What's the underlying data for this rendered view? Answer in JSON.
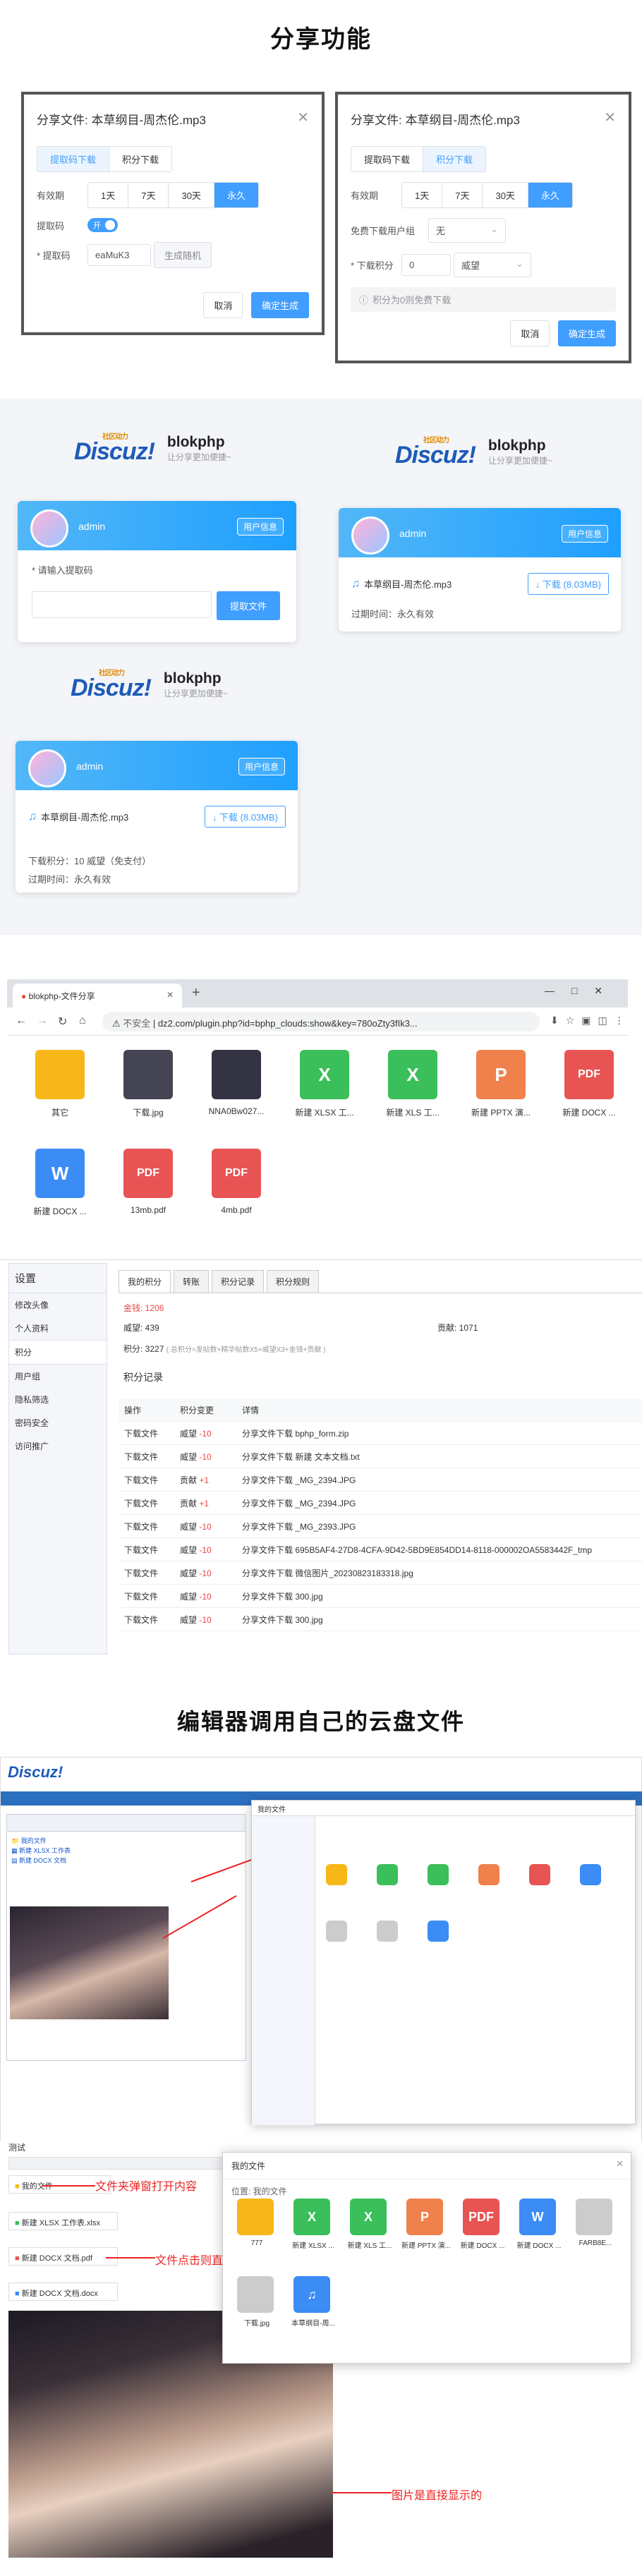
{
  "s1": {
    "title": "分享功能"
  },
  "dlgA": {
    "title": "分享文件: 本草纲目-周杰伦.mp3",
    "tabs": [
      "提取码下载",
      "积分下载"
    ],
    "validity_label": "有效期",
    "validity_opts": [
      "1天",
      "7天",
      "30天",
      "永久"
    ],
    "code_label": "提取码",
    "switch_text": "开",
    "code_label2": "* 提取码",
    "code_value": "eaMuK3",
    "gen_btn": "生成随机",
    "cancel": "取消",
    "ok": "确定生成"
  },
  "dlgB": {
    "title": "分享文件: 本草纲目-周杰伦.mp3",
    "tabs": [
      "提取码下载",
      "积分下载"
    ],
    "validity_label": "有效期",
    "validity_opts": [
      "1天",
      "7天",
      "30天",
      "永久"
    ],
    "group_label": "免费下载用户组",
    "group_value": "无",
    "points_label": "* 下载积分",
    "points_value": "0",
    "points_unit": "威望",
    "hint": "积分为0则免费下载",
    "cancel": "取消",
    "ok": "确定生成"
  },
  "brand": {
    "logo": "Discuz!",
    "logo_small": "社区动力",
    "name": "blokphp",
    "slogan": "让分享更加便捷~"
  },
  "cardA": {
    "user": "admin",
    "center": "用户信息",
    "label": "* 请输入提取码",
    "btn": "提取文件"
  },
  "cardB": {
    "user": "admin",
    "center": "用户信息",
    "file": "本草纲目-周杰伦.mp3",
    "dl": "↓ 下载 (8.03MB)",
    "expire": "过期时间：永久有效"
  },
  "cardC": {
    "user": "admin",
    "center": "用户信息",
    "file": "本草纲目-周杰伦.mp3",
    "dl": "↓ 下载 (8.03MB)",
    "points": "下载积分：10 威望（免支付）",
    "expire": "过期时间：永久有效"
  },
  "browser": {
    "tab": "blokphp-文件分享",
    "url": "dz2.com/plugin.php?id=bphp_clouds:show&key=780oZty3fIk3...",
    "insecure": "不安全"
  },
  "files": [
    {
      "name": "其它",
      "icon": "folder-icon",
      "color": "#f7b719"
    },
    {
      "name": "下载.jpg",
      "icon": "image-icon",
      "color": "#445"
    },
    {
      "name": "NNA0Bw027...",
      "icon": "image-icon",
      "color": "#334"
    },
    {
      "name": "新建 XLSX 工...",
      "icon": "xlsx-icon",
      "color": "#3bbf5a",
      "g": "X"
    },
    {
      "name": "新建 XLS 工...",
      "icon": "xls-icon",
      "color": "#3bbf5a",
      "g": "X"
    },
    {
      "name": "新建 PPTX 演...",
      "icon": "pptx-icon",
      "color": "#f0814d",
      "g": "P"
    },
    {
      "name": "新建 DOCX ...",
      "icon": "pdf-icon",
      "color": "#e85454",
      "g": "PDF"
    },
    {
      "name": "新建 DOCX ...",
      "icon": "docx-icon",
      "color": "#3b8cf5",
      "g": "W"
    },
    {
      "name": "13mb.pdf",
      "icon": "pdf-icon",
      "color": "#e85454",
      "g": "PDF"
    },
    {
      "name": "4mb.pdf",
      "icon": "pdf-icon",
      "color": "#e85454",
      "g": "PDF"
    }
  ],
  "settings": {
    "side": [
      "设置",
      "修改头像",
      "个人资料",
      "积分",
      "用户组",
      "隐私筛选",
      "密码安全",
      "访问推广"
    ],
    "tabs": [
      "我的积分",
      "转账",
      "积分记录",
      "积分规则"
    ],
    "gold": "金钱: 1206",
    "prestige": "威望: 439",
    "contrib": "贡献: 1071",
    "total": "积分: 3227",
    "total_note": "( 总积分=发帖数+精华帖数X5+威望X3+金钱+贡献 )",
    "records": "积分记录",
    "cols": [
      "操作",
      "积分变更",
      "详情"
    ]
  },
  "rows": [
    [
      "下载文件",
      "威望 -10",
      "分享文件下载 bphp_form.zip"
    ],
    [
      "下载文件",
      "威望 -10",
      "分享文件下载 新建 文本文档.txt"
    ],
    [
      "下载文件",
      "贡献 +1",
      "分享文件下载 _MG_2394.JPG"
    ],
    [
      "下载文件",
      "贡献 +1",
      "分享文件下载 _MG_2394.JPG"
    ],
    [
      "下载文件",
      "威望 -10",
      "分享文件下载 _MG_2393.JPG"
    ],
    [
      "下载文件",
      "威望 -10",
      "分享文件下载 695B5AF4-27D8-4CFA-9D42-5BD9E854DD14-8118-000002OA5583442F_tmp"
    ],
    [
      "下载文件",
      "威望 -10",
      "分享文件下载 微信图片_20230823183318.jpg"
    ],
    [
      "下载文件",
      "威望 -10",
      "分享文件下载 300.jpg"
    ],
    [
      "下载文件",
      "威望 -10",
      "分享文件下载 300.jpg"
    ]
  ],
  "s2": {
    "title": "编辑器调用自己的云盘文件"
  },
  "mydisk": {
    "title": "我的文件",
    "crumb": "位置: 我的文件",
    "files": [
      "777",
      "新建 XLSX ...",
      "新建 XLS 工...",
      "新建 PPTX 演...",
      "新建 DOCX ...",
      "新建 DOCX ...",
      "FARB8E...",
      "下载.jpg",
      "本草纲目-周..."
    ]
  },
  "anno": {
    "a1": "文件夹弹窗打开内容",
    "a2": "文件点击则直接下载",
    "a3": "图片是直接显示的"
  },
  "edit": {
    "label": "测试",
    "links": [
      "我的文件",
      "新建 XLSX 工作表.xlsx",
      "新建 DOCX 文档.pdf",
      "新建 DOCX 文档.docx"
    ]
  }
}
